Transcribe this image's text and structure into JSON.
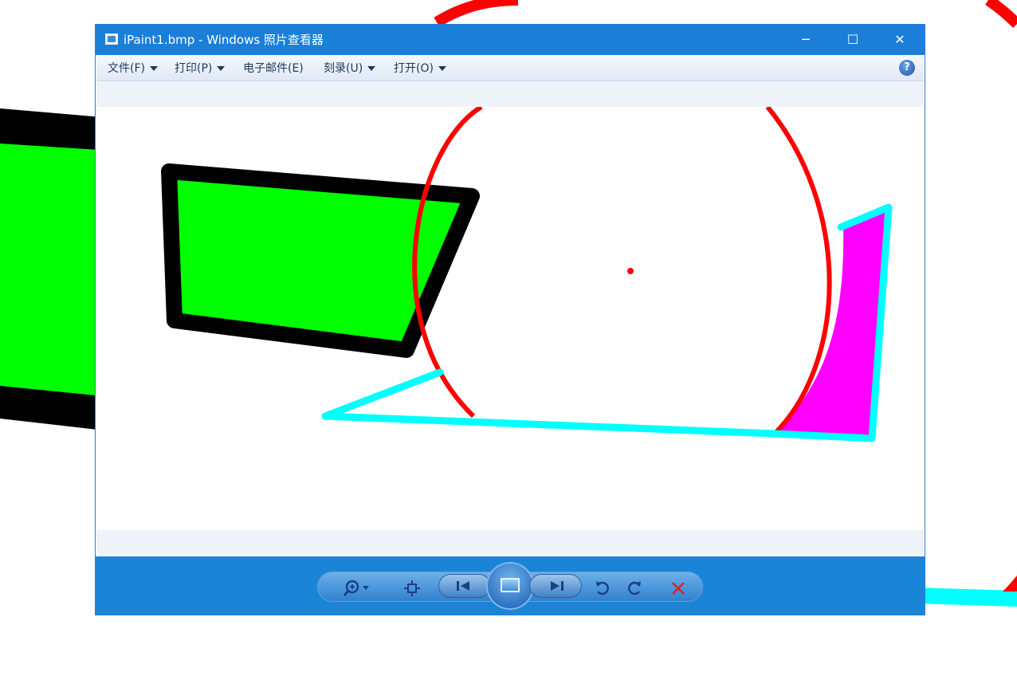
{
  "window": {
    "title": "iPaint1.bmp - Windows 照片查看器",
    "controls": {
      "minimize": "─",
      "maximize": "☐",
      "close": "✕"
    }
  },
  "menu": {
    "items": [
      {
        "label": "文件(F)",
        "has_dropdown": true
      },
      {
        "label": "打印(P)",
        "has_dropdown": true
      },
      {
        "label": "电子邮件(E)",
        "has_dropdown": false
      },
      {
        "label": "刻录(U)",
        "has_dropdown": true
      },
      {
        "label": "打开(O)",
        "has_dropdown": true
      }
    ],
    "help": "?"
  },
  "toolbar": {
    "buttons": [
      {
        "name": "zoom",
        "icon": "zoom-icon"
      },
      {
        "name": "actual-size",
        "icon": "fit-icon"
      },
      {
        "name": "previous",
        "icon": "previous-icon"
      },
      {
        "name": "slideshow",
        "icon": "slideshow-icon"
      },
      {
        "name": "next",
        "icon": "next-icon"
      },
      {
        "name": "rotate-counterclockwise",
        "icon": "rotate-ccw-icon"
      },
      {
        "name": "rotate-clockwise",
        "icon": "rotate-cw-icon"
      },
      {
        "name": "delete",
        "icon": "delete-icon"
      }
    ]
  },
  "image_colors": {
    "fill_green": "#00ff00",
    "stroke_black": "#000000",
    "circle_red": "#ff0000",
    "stroke_cyan": "#00ffff",
    "fill_magenta": "#ff00ff"
  },
  "theme": {
    "titlebar": "#1a7fd9",
    "controlbar": "#1a85d6"
  }
}
